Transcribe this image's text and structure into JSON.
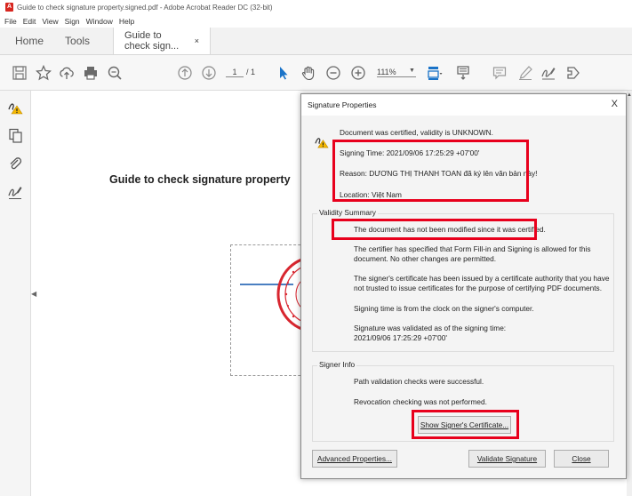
{
  "window": {
    "title": "Guide to check signature property.signed.pdf - Adobe Acrobat Reader DC (32-bit)"
  },
  "menu": [
    "File",
    "Edit",
    "View",
    "Sign",
    "Window",
    "Help"
  ],
  "tabs": {
    "home": "Home",
    "tools": "Tools",
    "doc": "Guide to check sign...",
    "close": "×"
  },
  "toolbar": {
    "page_current": "1",
    "page_total": "/ 1",
    "zoom": "111%"
  },
  "document": {
    "title": "Guide to check signature property"
  },
  "dialog": {
    "title": "Signature Properties",
    "close": "X",
    "status": "Document was certified, validity is UNKNOWN.",
    "signing_time": "Signing Time:  2021/09/06 17:25:29 +07'00'",
    "reason": "Reason:  DƯƠNG THỊ THANH TOAN đã ký lên văn bản này!",
    "location": "Location:  Việt Nam",
    "validity_label": "Validity Summary",
    "validity": [
      "The document has not been modified since it was certified.",
      "The certifier has specified that Form Fill-in and Signing is allowed for this document. No other changes are permitted.",
      "The signer's certificate has been issued by a certificate authority that you have not trusted to issue certificates for the purpose of certifying PDF documents.",
      "Signing time is from the clock on the signer's computer.",
      "Signature was validated as of the signing time: 2021/09/06 17:25:29 +07'00'"
    ],
    "signer_label": "Signer Info",
    "signer": [
      "Path validation checks were successful.",
      "Revocation checking was not performed."
    ],
    "buttons": {
      "show_cert": "Show Signer's Certificate...",
      "advanced": "Advanced Properties...",
      "validate": "Validate Signature",
      "close": "Close"
    }
  },
  "colors": {
    "highlight": "#e8001c",
    "adobe_red": "#d7261f",
    "stamp_red": "#d8262f"
  }
}
